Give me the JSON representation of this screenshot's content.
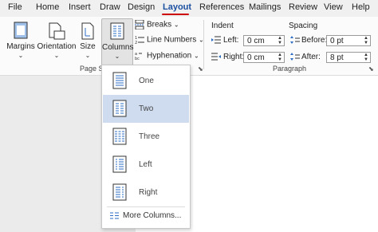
{
  "tabs": [
    {
      "label": "File"
    },
    {
      "label": "Home"
    },
    {
      "label": "Insert"
    },
    {
      "label": "Draw"
    },
    {
      "label": "Design"
    },
    {
      "label": "Layout"
    },
    {
      "label": "References"
    },
    {
      "label": "Mailings"
    },
    {
      "label": "Review"
    },
    {
      "label": "View"
    },
    {
      "label": "Help"
    }
  ],
  "active_tab": "Layout",
  "page_setup": {
    "margins": "Margins",
    "orientation": "Orientation",
    "size": "Size",
    "columns": "Columns",
    "breaks": "Breaks",
    "line_numbers": "Line Numbers",
    "hyphenation": "Hyphenation",
    "group_label": "Page S"
  },
  "paragraph": {
    "indent_title": "Indent",
    "left_label": "Left:",
    "left_value": "0 cm",
    "right_label": "Right:",
    "right_value": "0 cm",
    "spacing_title": "Spacing",
    "before_label": "Before:",
    "before_value": "0 pt",
    "after_label": "After:",
    "after_value": "8 pt",
    "group_label": "Paragraph"
  },
  "columns_menu": {
    "items": [
      {
        "label": "One",
        "icon": "one-column-icon"
      },
      {
        "label": "Two",
        "icon": "two-columns-icon"
      },
      {
        "label": "Three",
        "icon": "three-columns-icon"
      },
      {
        "label": "Left",
        "icon": "left-column-icon"
      },
      {
        "label": "Right",
        "icon": "right-column-icon"
      }
    ],
    "selected": "Two",
    "more": "More Columns..."
  },
  "colors": {
    "accent": "#1b4fa0",
    "active_tab_underline": "#cc0000",
    "selected_item": "#cfdcf0",
    "icon_blue": "#2b6cc4"
  }
}
